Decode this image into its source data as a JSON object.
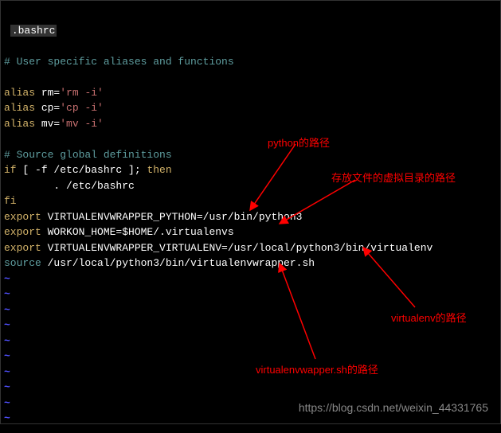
{
  "terminal": {
    "filename": ".bashrc",
    "comment_user": "# User specific aliases and functions",
    "alias_rm_kw": "alias",
    "alias_rm_name": " rm=",
    "alias_rm_val": "'rm -i'",
    "alias_cp_kw": "alias",
    "alias_cp_name": " cp=",
    "alias_cp_val": "'cp -i'",
    "alias_mv_kw": "alias",
    "alias_mv_name": " mv=",
    "alias_mv_val": "'mv -i'",
    "comment_source": "# Source global definitions",
    "if_kw": "if",
    "if_cond": " [ -f /etc/bashrc ]; ",
    "then_kw": "then",
    "source_line": "        . /etc/bashrc",
    "fi_kw": "fi",
    "export1_kw": "export",
    "export1_val": " VIRTUALENVWRAPPER_PYTHON=/usr/bin/python3",
    "export2_kw": "export",
    "export2_val": " WORKON_HOME=$HOME/.virtualenvs",
    "export3_kw": "export",
    "export3_val": " VIRTUALENVWRAPPER_VIRTUALENV=/usr/local/python3/bin/virtualenv",
    "source_kw": "source",
    "source_val": " /usr/local/python3/bin/virtualenvwrapper.sh",
    "tilde": "~"
  },
  "annotations": {
    "python_path": "python的路径",
    "virtualenv_dir": "存放文件的虚拟目录的路径",
    "virtualenv_path": "virtualenv的路径",
    "wrapper_path": "virtualenvwapper.sh的路径"
  },
  "watermark": "https://blog.csdn.net/weixin_44331765"
}
